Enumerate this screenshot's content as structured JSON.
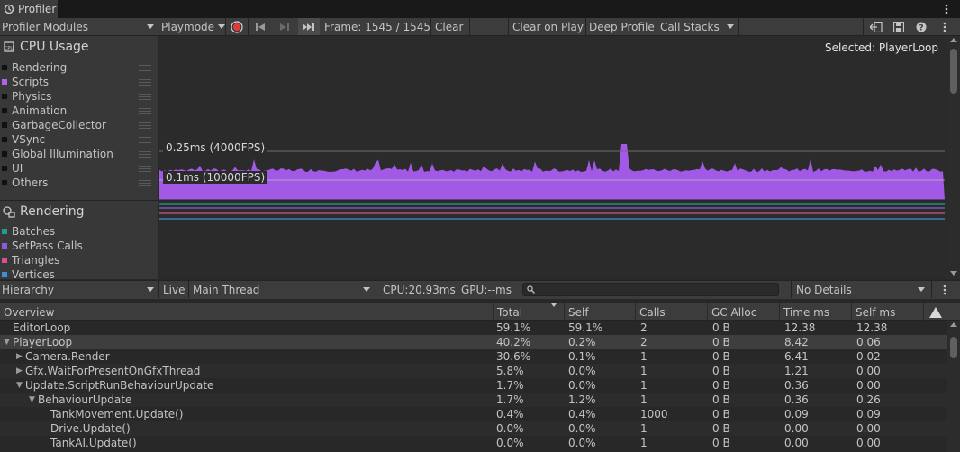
{
  "window": {
    "title": "Profiler",
    "menu_icon": "kebab-menu-icon"
  },
  "toolbar": {
    "modules_dropdown": "Profiler Modules",
    "playmode_dropdown": "Playmode",
    "frame_label": "Frame: 1545 / 1545",
    "clear": "Clear",
    "clear_on_play": "Clear on Play",
    "deep_profile": "Deep Profile",
    "call_stacks": "Call Stacks"
  },
  "cpu_module": {
    "title": "CPU Usage",
    "legend": [
      {
        "label": "Rendering",
        "color": "#111111"
      },
      {
        "label": "Scripts",
        "color": "#b061ee"
      },
      {
        "label": "Physics",
        "color": "#111111"
      },
      {
        "label": "Animation",
        "color": "#111111"
      },
      {
        "label": "GarbageCollector",
        "color": "#111111"
      },
      {
        "label": "VSync",
        "color": "#111111"
      },
      {
        "label": "Global Illumination",
        "color": "#111111"
      },
      {
        "label": "UI",
        "color": "#111111"
      },
      {
        "label": "Others",
        "color": "#111111"
      }
    ]
  },
  "rendering_module": {
    "title": "Rendering",
    "legend": [
      {
        "label": "Batches",
        "color": "#1f9e8f"
      },
      {
        "label": "SetPass Calls",
        "color": "#8d5ad8"
      },
      {
        "label": "Triangles",
        "color": "#d8508f"
      },
      {
        "label": "Vertices",
        "color": "#3c8fd8"
      }
    ],
    "line_colors": [
      "#1f9e8f",
      "#8d5ad8",
      "#d8508f",
      "#3c8fd8"
    ]
  },
  "chart": {
    "selected_label": "Selected: PlayerLoop",
    "marker_high": "0.25ms (4000FPS)",
    "marker_low": "0.1ms (10000FPS)",
    "fill_color": "#a259e6"
  },
  "hierarchy_bar": {
    "view_dropdown": "Hierarchy",
    "live": "Live",
    "thread_dropdown": "Main Thread",
    "cpu": "CPU:20.93ms",
    "gpu": "GPU:--ms",
    "search_placeholder": "",
    "details_dropdown": "No Details"
  },
  "columns": [
    "Overview",
    "Total",
    "Self",
    "Calls",
    "GC Alloc",
    "Time ms",
    "Self ms"
  ],
  "rows": [
    {
      "name": "EditorLoop",
      "indent": 0,
      "arrow": "",
      "total": "59.1%",
      "self": "59.1%",
      "calls": "2",
      "gc": "0 B",
      "time": "12.38",
      "selfms": "12.38"
    },
    {
      "name": "PlayerLoop",
      "indent": 0,
      "arrow": "▼",
      "total": "40.2%",
      "self": "0.2%",
      "calls": "2",
      "gc": "0 B",
      "time": "8.42",
      "selfms": "0.06",
      "selected": true
    },
    {
      "name": "Camera.Render",
      "indent": 1,
      "arrow": "▶",
      "total": "30.6%",
      "self": "0.1%",
      "calls": "1",
      "gc": "0 B",
      "time": "6.41",
      "selfms": "0.02"
    },
    {
      "name": "Gfx.WaitForPresentOnGfxThread",
      "indent": 1,
      "arrow": "▶",
      "total": "5.8%",
      "self": "0.0%",
      "calls": "1",
      "gc": "0 B",
      "time": "1.21",
      "selfms": "0.00"
    },
    {
      "name": "Update.ScriptRunBehaviourUpdate",
      "indent": 1,
      "arrow": "▼",
      "total": "1.7%",
      "self": "0.0%",
      "calls": "1",
      "gc": "0 B",
      "time": "0.36",
      "selfms": "0.00"
    },
    {
      "name": "BehaviourUpdate",
      "indent": 2,
      "arrow": "▼",
      "total": "1.7%",
      "self": "1.2%",
      "calls": "1",
      "gc": "0 B",
      "time": "0.36",
      "selfms": "0.26"
    },
    {
      "name": "TankMovement.Update()",
      "indent": 3,
      "arrow": "",
      "total": "0.4%",
      "self": "0.4%",
      "calls": "1000",
      "gc": "0 B",
      "time": "0.09",
      "selfms": "0.09"
    },
    {
      "name": "Drive.Update()",
      "indent": 3,
      "arrow": "",
      "total": "0.0%",
      "self": "0.0%",
      "calls": "1",
      "gc": "0 B",
      "time": "0.00",
      "selfms": "0.00"
    },
    {
      "name": "TankAI.Update()",
      "indent": 3,
      "arrow": "",
      "total": "0.0%",
      "self": "0.0%",
      "calls": "1",
      "gc": "0 B",
      "time": "0.00",
      "selfms": "0.00"
    }
  ]
}
